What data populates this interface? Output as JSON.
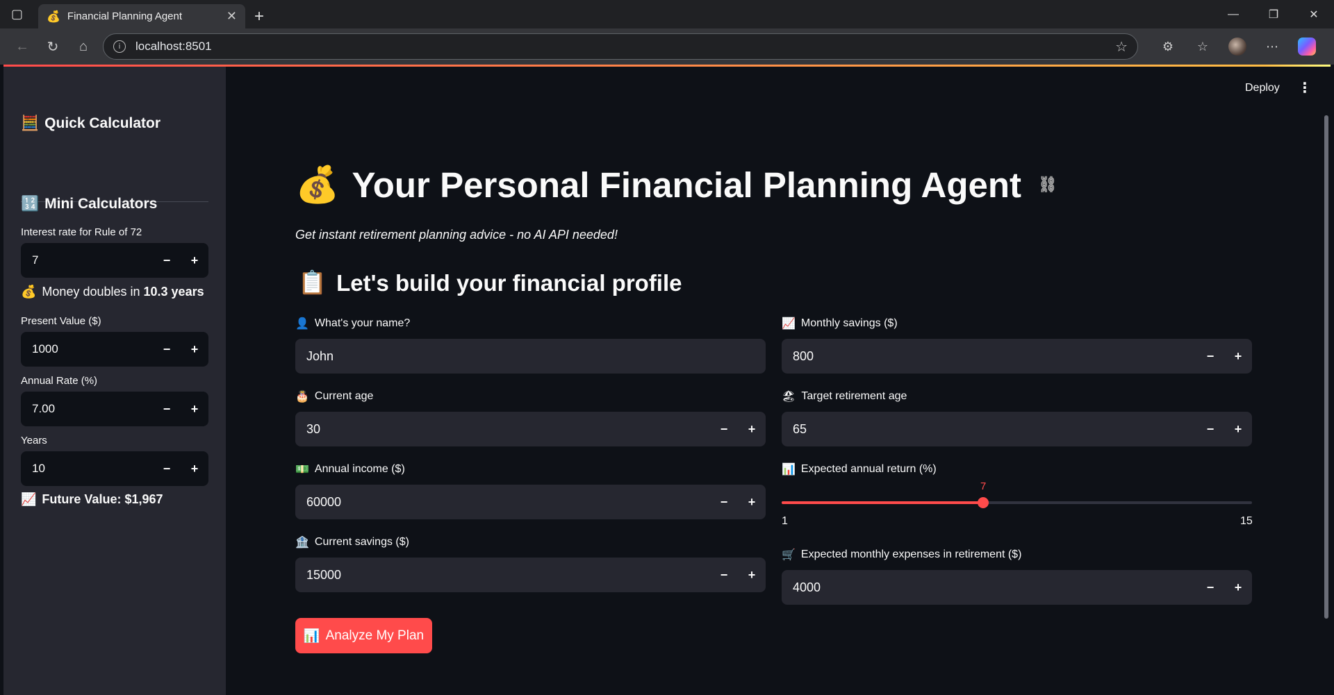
{
  "browser": {
    "tab_title": "Financial Planning Agent",
    "tab_favicon": "💰",
    "url": "localhost:8501"
  },
  "header": {
    "deploy_label": "Deploy",
    "menu_icon": "⋮"
  },
  "sidebar": {
    "quick_calc_title": "Quick Calculator",
    "quick_calc_icon": "🧮",
    "mini_calc_title": "Mini Calculators",
    "mini_calc_icon": "🔢",
    "rule72_label": "Interest rate for Rule of 72",
    "rule72_value": "7",
    "doubles_icon": "💰",
    "doubles_prefix": "Money doubles in ",
    "doubles_value": "10.3 years",
    "pv_label": "Present Value ($)",
    "pv_value": "1000",
    "rate_label": "Annual Rate (%)",
    "rate_value": "7.00",
    "years_label": "Years",
    "years_value": "10",
    "fv_icon": "📈",
    "fv_text": "Future Value: $1,967"
  },
  "main": {
    "title_icon": "💰",
    "title": "Your Personal Financial Planning Agent",
    "subtitle": "Get instant retirement planning advice - no AI API needed!",
    "section_icon": "📋",
    "section_title": "Let's build your financial profile",
    "name": {
      "icon": "👤",
      "label": "What's your name?",
      "value": "John"
    },
    "age": {
      "icon": "🎂",
      "label": "Current age",
      "value": "30"
    },
    "income": {
      "icon": "💵",
      "label": "Annual income ($)",
      "value": "60000"
    },
    "savings": {
      "icon": "🏦",
      "label": "Current savings ($)",
      "value": "15000"
    },
    "monthly": {
      "icon": "📈",
      "label": "Monthly savings ($)",
      "value": "800"
    },
    "retire_age": {
      "icon": "🏖",
      "label": "Target retirement age",
      "value": "65"
    },
    "return": {
      "icon": "📊",
      "label": "Expected annual return (%)",
      "value": 7,
      "min": 1,
      "max": 15
    },
    "expenses": {
      "icon": "🛒",
      "label": "Expected monthly expenses in retirement ($)",
      "value": "4000"
    },
    "analyze_icon": "📊",
    "analyze_label": "Analyze My Plan"
  },
  "colors": {
    "accent": "#ff4b4b",
    "background": "#0e1117",
    "sidebar": "#262730"
  }
}
